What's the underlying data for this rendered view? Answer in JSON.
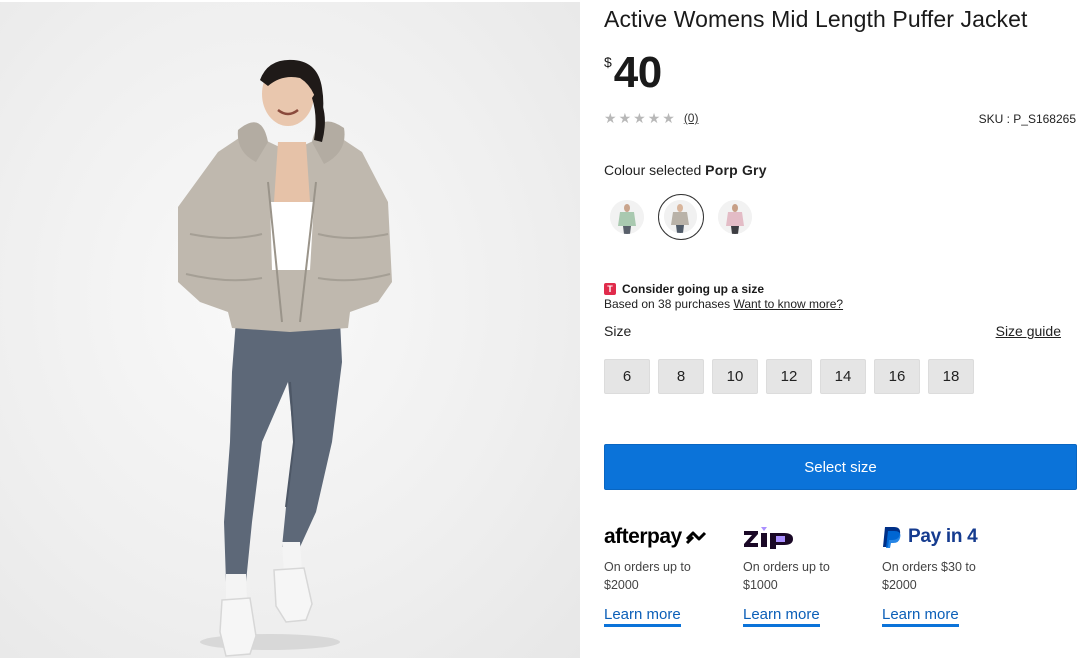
{
  "product": {
    "title": "Active Womens Mid Length Puffer Jacket",
    "currency_symbol": "$",
    "price": "40",
    "rating_stars": 0,
    "review_count": "(0)",
    "sku": "SKU : P_S168265"
  },
  "colour": {
    "label": "Colour selected",
    "selected": "Porp Gry",
    "swatches": [
      {
        "name": "green",
        "color": "#a9c9b0"
      },
      {
        "name": "porp-gry",
        "color": "#b9b2a8",
        "selected": true
      },
      {
        "name": "pink",
        "color": "#e3bcc6"
      }
    ]
  },
  "fit_advice": {
    "logo_letter": "T",
    "headline": "Consider going up a size",
    "detail": "Based on 38 purchases",
    "link": "Want to know more?"
  },
  "sizes": {
    "label": "Size",
    "guide_link": "Size guide",
    "options": [
      "6",
      "8",
      "10",
      "12",
      "14",
      "16",
      "18"
    ]
  },
  "cta": {
    "label": "Select size"
  },
  "payments": [
    {
      "name": "afterpay",
      "logo_text": "afterpay",
      "desc_line1": "On orders up to",
      "desc_line2": "$2000",
      "link": "Learn more"
    },
    {
      "name": "zip",
      "logo_text": "zip",
      "desc_line1": "On orders up to",
      "desc_line2": "$1000",
      "link": "Learn more"
    },
    {
      "name": "paypal",
      "logo_text": "Pay in 4",
      "desc_line1": "On orders $30 to",
      "desc_line2": "$2000",
      "link": "Learn more"
    }
  ],
  "colors": {
    "accent": "#0b73d9",
    "size_button_bg": "#e5e5e5",
    "star_empty": "#b8b8b8",
    "fit_logo": "#e02b4b"
  }
}
